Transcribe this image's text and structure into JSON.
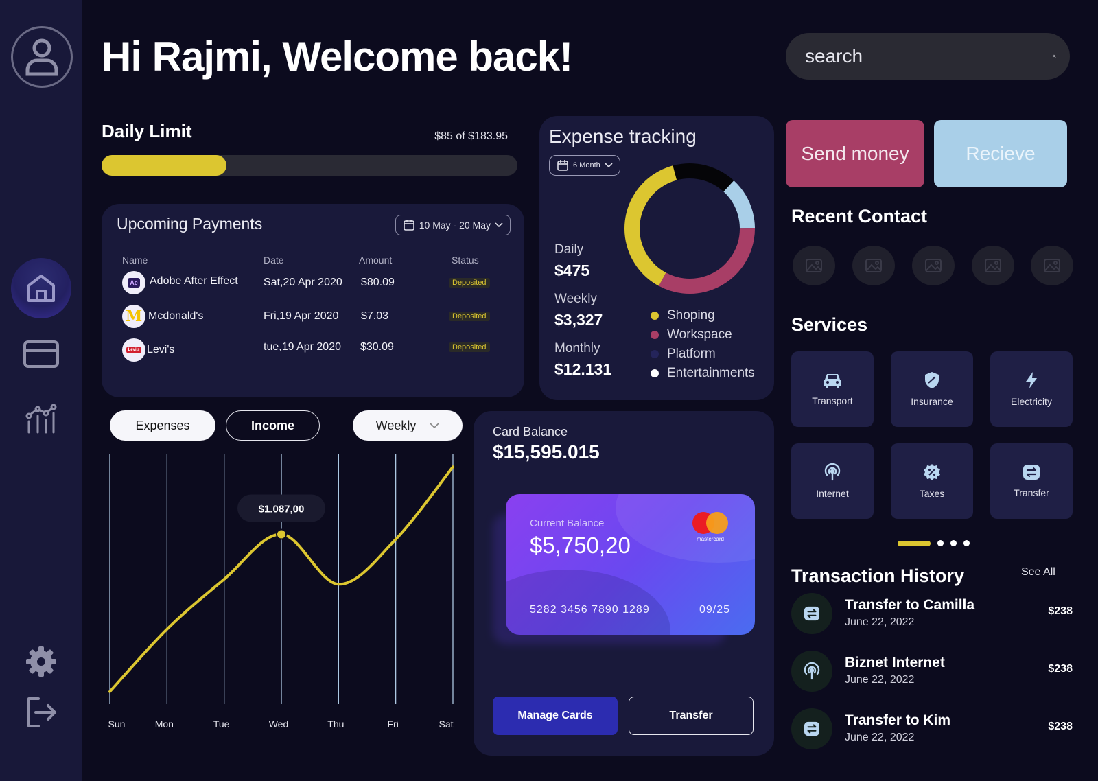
{
  "greeting": "Hi Rajmi, Welcome back!",
  "search": {
    "placeholder": "search"
  },
  "daily_limit": {
    "title": "Daily Limit",
    "amount_text": "$85 of $183.95",
    "fill_fraction": 0.3
  },
  "upcoming": {
    "title": "Upcoming Payments",
    "date_range": "10 May - 20 May",
    "headers": {
      "name": "Name",
      "date": "Date",
      "amount": "Amount",
      "status": "Status"
    },
    "rows": [
      {
        "logo": "Ae",
        "name": "Adobe After Effect",
        "date": "Sat,20 Apr 2020",
        "amount": "$80.09",
        "status": "Deposited"
      },
      {
        "logo": "M",
        "name": "Mcdonald's",
        "date": "Fri,19 Apr 2020",
        "amount": "$7.03",
        "status": "Deposited"
      },
      {
        "logo": "Levi's",
        "name": "Levi's",
        "date": "tue,19 Apr 2020",
        "amount": "$30.09",
        "status": "Deposited"
      }
    ]
  },
  "expense": {
    "title": "Expense tracking",
    "period": "6 Month",
    "daily_label": "Daily",
    "daily_value": "$475",
    "weekly_label": "Weekly",
    "weekly_value": "$3,327",
    "monthly_label": "Monthly",
    "monthly_value": "$12.131",
    "legend": [
      {
        "name": "Shoping",
        "color": "#dcc630"
      },
      {
        "name": "Workspace",
        "color": "#a83e66"
      },
      {
        "name": "Platform",
        "color": "#1f1f4a"
      },
      {
        "name": "Entertainments",
        "color": "#ffffff"
      }
    ],
    "donut_segments": [
      {
        "name": "Black",
        "color": "#050508",
        "fraction": 0.16
      },
      {
        "name": "Entertainments",
        "color": "#a9cfe8",
        "fraction": 0.13
      },
      {
        "name": "Workspace",
        "color": "#a83e66",
        "fraction": 0.33
      },
      {
        "name": "Shoping",
        "color": "#dcc630",
        "fraction": 0.38
      }
    ]
  },
  "tabs": {
    "expenses": "Expenses",
    "income": "Income",
    "period": "Weekly"
  },
  "chart_data": {
    "type": "line",
    "categories": [
      "Sun",
      "Mon",
      "Tue",
      "Wed",
      "Thu",
      "Fri",
      "Sat"
    ],
    "values": [
      0.05,
      0.3,
      0.5,
      0.68,
      0.48,
      0.66,
      0.95
    ],
    "highlight_index": 3,
    "highlight_label": "$1.087,00",
    "line_color": "#dcc630"
  },
  "balance": {
    "label": "Card Balance",
    "value": "$15,595.015",
    "card": {
      "label": "Current Balance",
      "value": "$5,750,20",
      "number": "5282 3456 7890 1289",
      "expiry": "09/25",
      "brand": "mastercard"
    },
    "manage_label": "Manage Cards",
    "transfer_label": "Transfer"
  },
  "actions": {
    "send": "Send money",
    "receive": "Recieve"
  },
  "recent_contact_title": "Recent Contact",
  "services_title": "Services",
  "services": [
    {
      "label": "Transport",
      "icon": "car-icon"
    },
    {
      "label": "Insurance",
      "icon": "shield-icon"
    },
    {
      "label": "Electricity",
      "icon": "lightning-icon"
    },
    {
      "label": "Internet",
      "icon": "wifi-icon"
    },
    {
      "label": "Taxes",
      "icon": "tax-badge-icon"
    },
    {
      "label": "Transfer",
      "icon": "transfer-icon"
    }
  ],
  "transactions": {
    "title": "Transaction History",
    "see_all": "See All",
    "items": [
      {
        "name": "Transfer to Camilla",
        "date": "June 22, 2022",
        "amount": "$238",
        "icon": "transfer-icon"
      },
      {
        "name": "Biznet Internet",
        "date": "June 22, 2022",
        "amount": "$238",
        "icon": "wifi-icon"
      },
      {
        "name": "Transfer to Kim",
        "date": "June 22, 2022",
        "amount": "$238",
        "icon": "transfer-icon"
      }
    ]
  }
}
